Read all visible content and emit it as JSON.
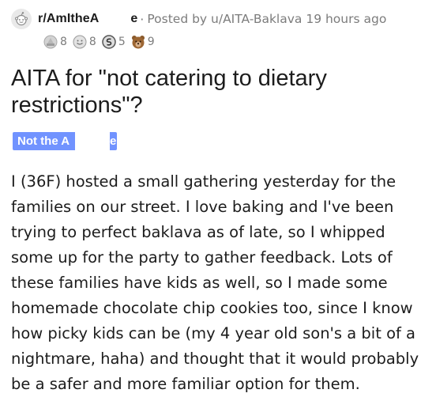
{
  "post": {
    "subreddit_visible": "r/AmItheA",
    "subreddit_tail": "e",
    "separator": "·",
    "posted_by": "Posted by u/AITA-Baklava 19 hours ago",
    "awards": [
      {
        "icon": "silver-award-icon",
        "count": "8"
      },
      {
        "icon": "helpful-award-icon",
        "count": "8"
      },
      {
        "icon": "wholesome-award-icon",
        "count": "5"
      },
      {
        "icon": "bear-award-icon",
        "count": "9"
      }
    ],
    "title": "AITA for \"not catering to dietary restrictions\"?",
    "flair_visible": "Not the A",
    "flair_tail": "e",
    "flair_color": "#7193ff",
    "body": "I (36F) hosted a small gathering yesterday for the families on our street. I love baking and I've been trying to perfect baklava as of late, so I whipped some up for the party to gather feedback. Lots of these families have kids as well, so I made some homemade chocolate chip cookies too, since I know how picky kids can be (my 4 year old son's a bit of a nightmare, haha) and thought that it would probably be a safer and more familiar option for them."
  }
}
